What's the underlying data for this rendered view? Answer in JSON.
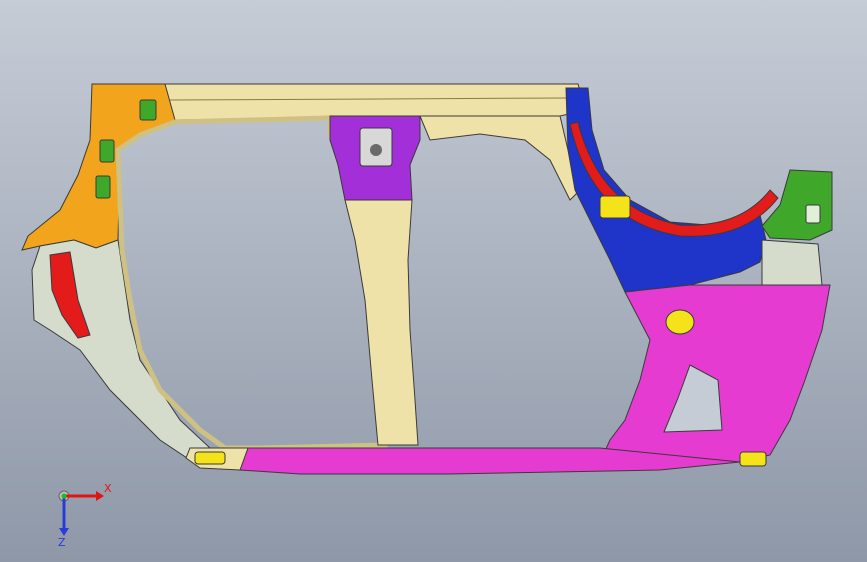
{
  "viewport": {
    "background_top": "#c5ccd6",
    "background_bottom": "#8f98a8"
  },
  "model": {
    "colors": {
      "cream": "#efe2a8",
      "cream_dark": "#cfc084",
      "orange": "#f2a51c",
      "purple": "#a22fd8",
      "blue": "#1f34c8",
      "red": "#e31b1b",
      "magenta": "#e63bd0",
      "green": "#3fa82a",
      "yellow": "#f4e21a",
      "grey": "#d6dccc",
      "outline": "#3a3a3a"
    }
  },
  "triad": {
    "x_label": "X",
    "z_label": "Z",
    "x_color": "#e01414",
    "y_color": "#1bbf1b",
    "z_color": "#2a3cd8"
  }
}
